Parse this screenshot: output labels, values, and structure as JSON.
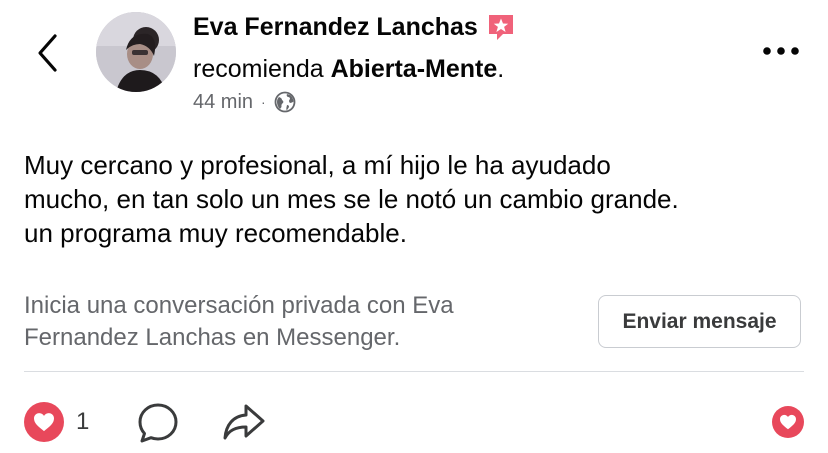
{
  "header": {
    "author_name": "Eva Fernandez Lanchas",
    "recommends_text": "recomienda ",
    "page_name": "Abierta-Mente",
    "period": ".",
    "time_ago": "44 min",
    "separator": "·",
    "icons": {
      "back": "chevron-left-icon",
      "badge": "star-badge-icon",
      "audience": "globe-icon",
      "more": "more-dots-icon"
    },
    "badge_color": "#f0627a"
  },
  "review": {
    "lines": [
      "Muy cercano y profesional, a mí hijo le ha ayudado",
      "mucho, en tan solo un mes se le notó un cambio grande.",
      "un programa muy recomendable."
    ]
  },
  "messenger": {
    "lines": [
      "Inicia una conversación privada con Eva",
      "Fernandez Lanchas en Messenger."
    ],
    "button_label": "Enviar mensaje"
  },
  "footer": {
    "love_count": "1",
    "icons": {
      "love": "heart-reaction-icon",
      "comment": "comment-icon",
      "share": "share-icon",
      "react": "heart-reaction-icon"
    },
    "love_color": "#e8485b"
  }
}
